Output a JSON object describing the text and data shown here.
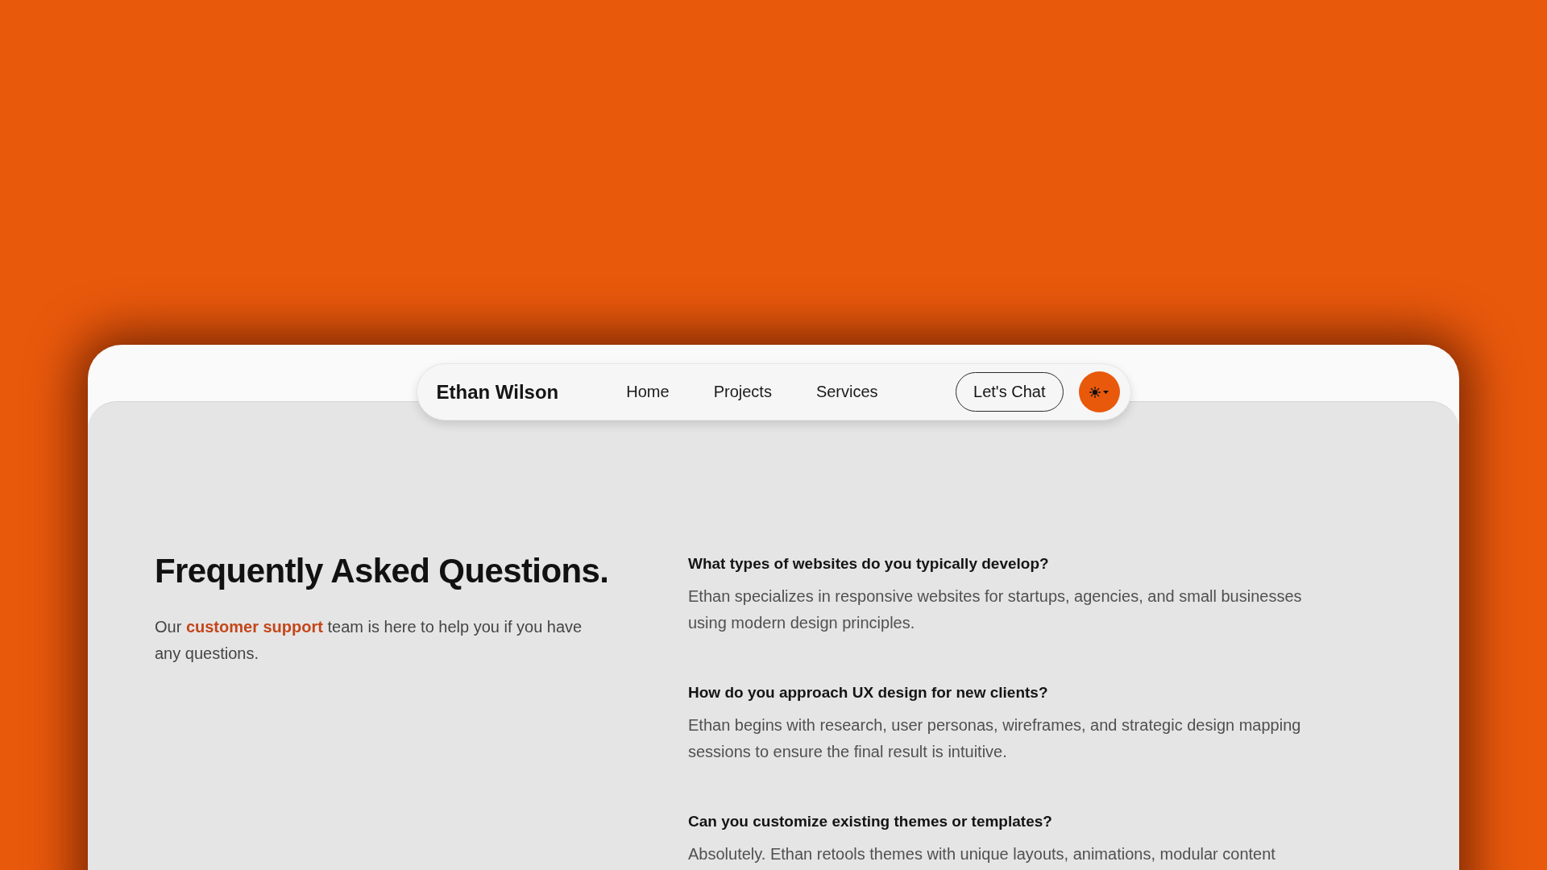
{
  "navbar": {
    "brand": "Ethan Wilson",
    "links": [
      {
        "label": "Home"
      },
      {
        "label": "Projects"
      },
      {
        "label": "Services"
      }
    ],
    "cta": "Let's Chat"
  },
  "faq": {
    "title": "Frequently Asked Questions.",
    "intro": {
      "before": "Our",
      "link": "customer support",
      "after": "team is here to help you if you have any questions."
    },
    "questions": [
      {
        "question": "What types of websites do you typically develop?",
        "answer": "Ethan specializes in responsive websites for startups, agencies, and small businesses using modern design principles."
      },
      {
        "question": "How do you approach UX design for new clients?",
        "answer": "Ethan begins with research, user personas, wireframes, and strategic design mapping sessions to ensure the final result is intuitive."
      },
      {
        "question": "Can you customize existing themes or templates?",
        "answer": "Absolutely. Ethan retools themes with unique layouts, animations, modular content"
      }
    ]
  }
}
